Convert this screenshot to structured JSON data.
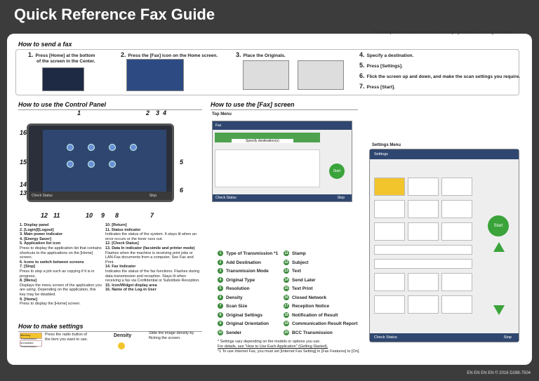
{
  "title": "Quick Reference Fax Guide",
  "top_note": "* The shape of the machine and screen displays varies according to models.",
  "send": {
    "heading": "How to send a fax",
    "steps": [
      {
        "num": "1.",
        "line1": "Press [Home] at the bottom",
        "line2": "of the screen in the Center."
      },
      {
        "num": "2.",
        "line1": "Press the [Fax] icon on the Home screen.",
        "line2": ""
      },
      {
        "num": "3.",
        "line1": "Place the Originals.",
        "line2": ""
      }
    ],
    "more_steps": [
      {
        "num": "4.",
        "text": "Specify a destination."
      },
      {
        "num": "5.",
        "text": "Press [Settings]."
      },
      {
        "num": "6.",
        "text": "Flick the screen up and down, and make the scan settings you require."
      },
      {
        "num": "7.",
        "text": "Press [Start]."
      }
    ]
  },
  "panel": {
    "heading": "How to use the Control Panel",
    "callouts": [
      "1",
      "2",
      "3",
      "4",
      "5",
      "6",
      "7",
      "8",
      "9",
      "10",
      "11",
      "12",
      "13",
      "14",
      "15",
      "16"
    ],
    "screen_bar": "Check Status",
    "stop": "Stop",
    "legend_left": [
      {
        "n": "1.",
        "title": "Display panel",
        "desc": ""
      },
      {
        "n": "2.",
        "title": "[Login]/[Logout]",
        "desc": ""
      },
      {
        "n": "3.",
        "title": "Main power indicator",
        "desc": ""
      },
      {
        "n": "4.",
        "title": "[Energy Saver]",
        "desc": ""
      },
      {
        "n": "5.",
        "title": "Application list icon",
        "desc": "Press to display the application list that contains shortcuts to the applications on the [Home] screen."
      },
      {
        "n": "6.",
        "title": "Icons to switch between screens",
        "desc": ""
      },
      {
        "n": "7.",
        "title": "[Stop]",
        "desc": "Press to stop a job such as copying if it is in progress."
      },
      {
        "n": "8.",
        "title": "[Menu]",
        "desc": "Displays the menu screen of the application you are using. Depending on the application, this key may be disabled."
      },
      {
        "n": "9.",
        "title": "[Home]",
        "desc": "Press to display the [Home] screen."
      }
    ],
    "legend_right": [
      {
        "n": "10.",
        "title": "[Return]",
        "desc": ""
      },
      {
        "n": "11.",
        "title": "Status indicator",
        "desc": "Indicates the status of the system. It stays lit when an error occurs or the toner runs out."
      },
      {
        "n": "12.",
        "title": "[Check Status]",
        "desc": ""
      },
      {
        "n": "13.",
        "title": "Data In indicator (facsimile and printer mode)",
        "desc": "Flashes when the machine is receiving print jobs or LAN-Fax documents from a computer. See Fax and Print."
      },
      {
        "n": "14.",
        "title": "Fax Indicator",
        "desc": "Indicates the status of the fax functions. Flashes during data transmission and reception. Stays lit when receiving a fax via Confidential or Substitute Reception."
      },
      {
        "n": "15.",
        "title": "Icon/Widget display area",
        "desc": ""
      },
      {
        "n": "16.",
        "title": "Name of the Log-in User",
        "desc": ""
      }
    ]
  },
  "make_settings": {
    "heading": "How to make settings",
    "tile1": "Memory Transmission",
    "tile2": "Immediate Transmission",
    "desc1": "Press the radio button of the item you want to use.",
    "density_label": "Density",
    "desc2": "Slide the image density by flicking the screen."
  },
  "fax_screen": {
    "heading": "How to use the [Fax] screen",
    "top_menu_label": "Top Menu",
    "fax_label": "Fax",
    "specify": "Specify destination(s)",
    "start": "Start",
    "check_status": "Check Status",
    "stop": "Stop",
    "settings_menu_label": "Settings Menu",
    "settings_title": "Settings",
    "items": [
      {
        "n": "1",
        "label": "Type of Transmission *1"
      },
      {
        "n": "2",
        "label": "Add Destination"
      },
      {
        "n": "3",
        "label": "Transmission Mode"
      },
      {
        "n": "4",
        "label": "Original Type"
      },
      {
        "n": "5",
        "label": "Resolution"
      },
      {
        "n": "6",
        "label": "Density"
      },
      {
        "n": "7",
        "label": "Scan Size"
      },
      {
        "n": "8",
        "label": "Original Settings"
      },
      {
        "n": "9",
        "label": "Original Orientation"
      },
      {
        "n": "10",
        "label": "Sender"
      }
    ],
    "items2": [
      {
        "n": "11",
        "label": "Stamp"
      },
      {
        "n": "12",
        "label": "Subject"
      },
      {
        "n": "13",
        "label": "Text"
      },
      {
        "n": "14",
        "label": "Send Later"
      },
      {
        "n": "15",
        "label": "Text Print"
      },
      {
        "n": "16",
        "label": "Closed Network"
      },
      {
        "n": "17",
        "label": "Reception Notice"
      },
      {
        "n": "18",
        "label": "Notification of Result"
      },
      {
        "n": "19",
        "label": "Communication Result Report"
      },
      {
        "n": "20",
        "label": "BCC Transmission"
      }
    ],
    "footnote1": "* Settings vary depending on the models or options you use.",
    "footnote2": "For details, see \"How to Use Each Application\" (Getting Started).",
    "footnote3": "*1 To use Internet Fax, you must set [Internet Fax Setting] in [Fax Features] to [On]."
  },
  "footer": "EN  EN  EN  EN  © 2016   D288-7504"
}
